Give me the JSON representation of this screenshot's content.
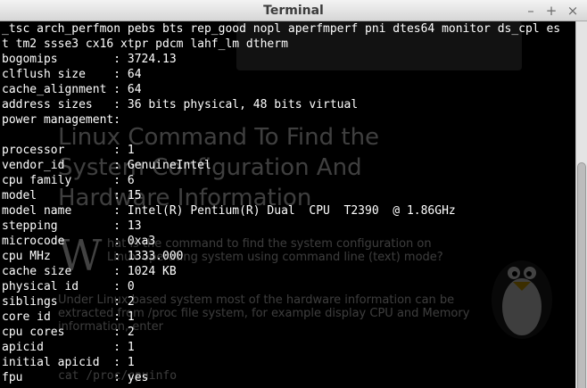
{
  "window": {
    "title": "Terminal",
    "minimize_glyph": "–",
    "maximize_glyph": "+",
    "close_glyph": "×"
  },
  "terminal": {
    "lines": [
      "_tsc arch_perfmon pebs bts rep_good nopl aperfmperf pni dtes64 monitor ds_cpl es",
      "t tm2 ssse3 cx16 xtpr pdcm lahf_lm dtherm",
      "bogomips        : 3724.13",
      "clflush size    : 64",
      "cache_alignment : 64",
      "address sizes   : 36 bits physical, 48 bits virtual",
      "power management:",
      "",
      "processor       : 1",
      "vendor_id       : GenuineIntel",
      "cpu family      : 6",
      "model           : 15",
      "model name      : Intel(R) Pentium(R) Dual  CPU  T2390  @ 1.86GHz",
      "stepping        : 13",
      "microcode       : 0xa3",
      "cpu MHz         : 1333.000",
      "cache size      : 1024 KB",
      "physical id     : 0",
      "siblings        : 2",
      "core id         : 1",
      "cpu cores       : 2",
      "apicid          : 1",
      "initial apicid  : 1",
      "fpu             : yes"
    ]
  },
  "background_page": {
    "heading": "Linux Command To Find the System Configuration And Hardware Information",
    "dropcap": "W",
    "para1": "hat is the command to find the system configuration on Linux operating system using command line (text) mode?",
    "para2": "Under Linux based system most of the hardware information can be extracted from /proc file system, for example display CPU and Memory information, enter",
    "code": "cat /proc/cpuinfo"
  }
}
